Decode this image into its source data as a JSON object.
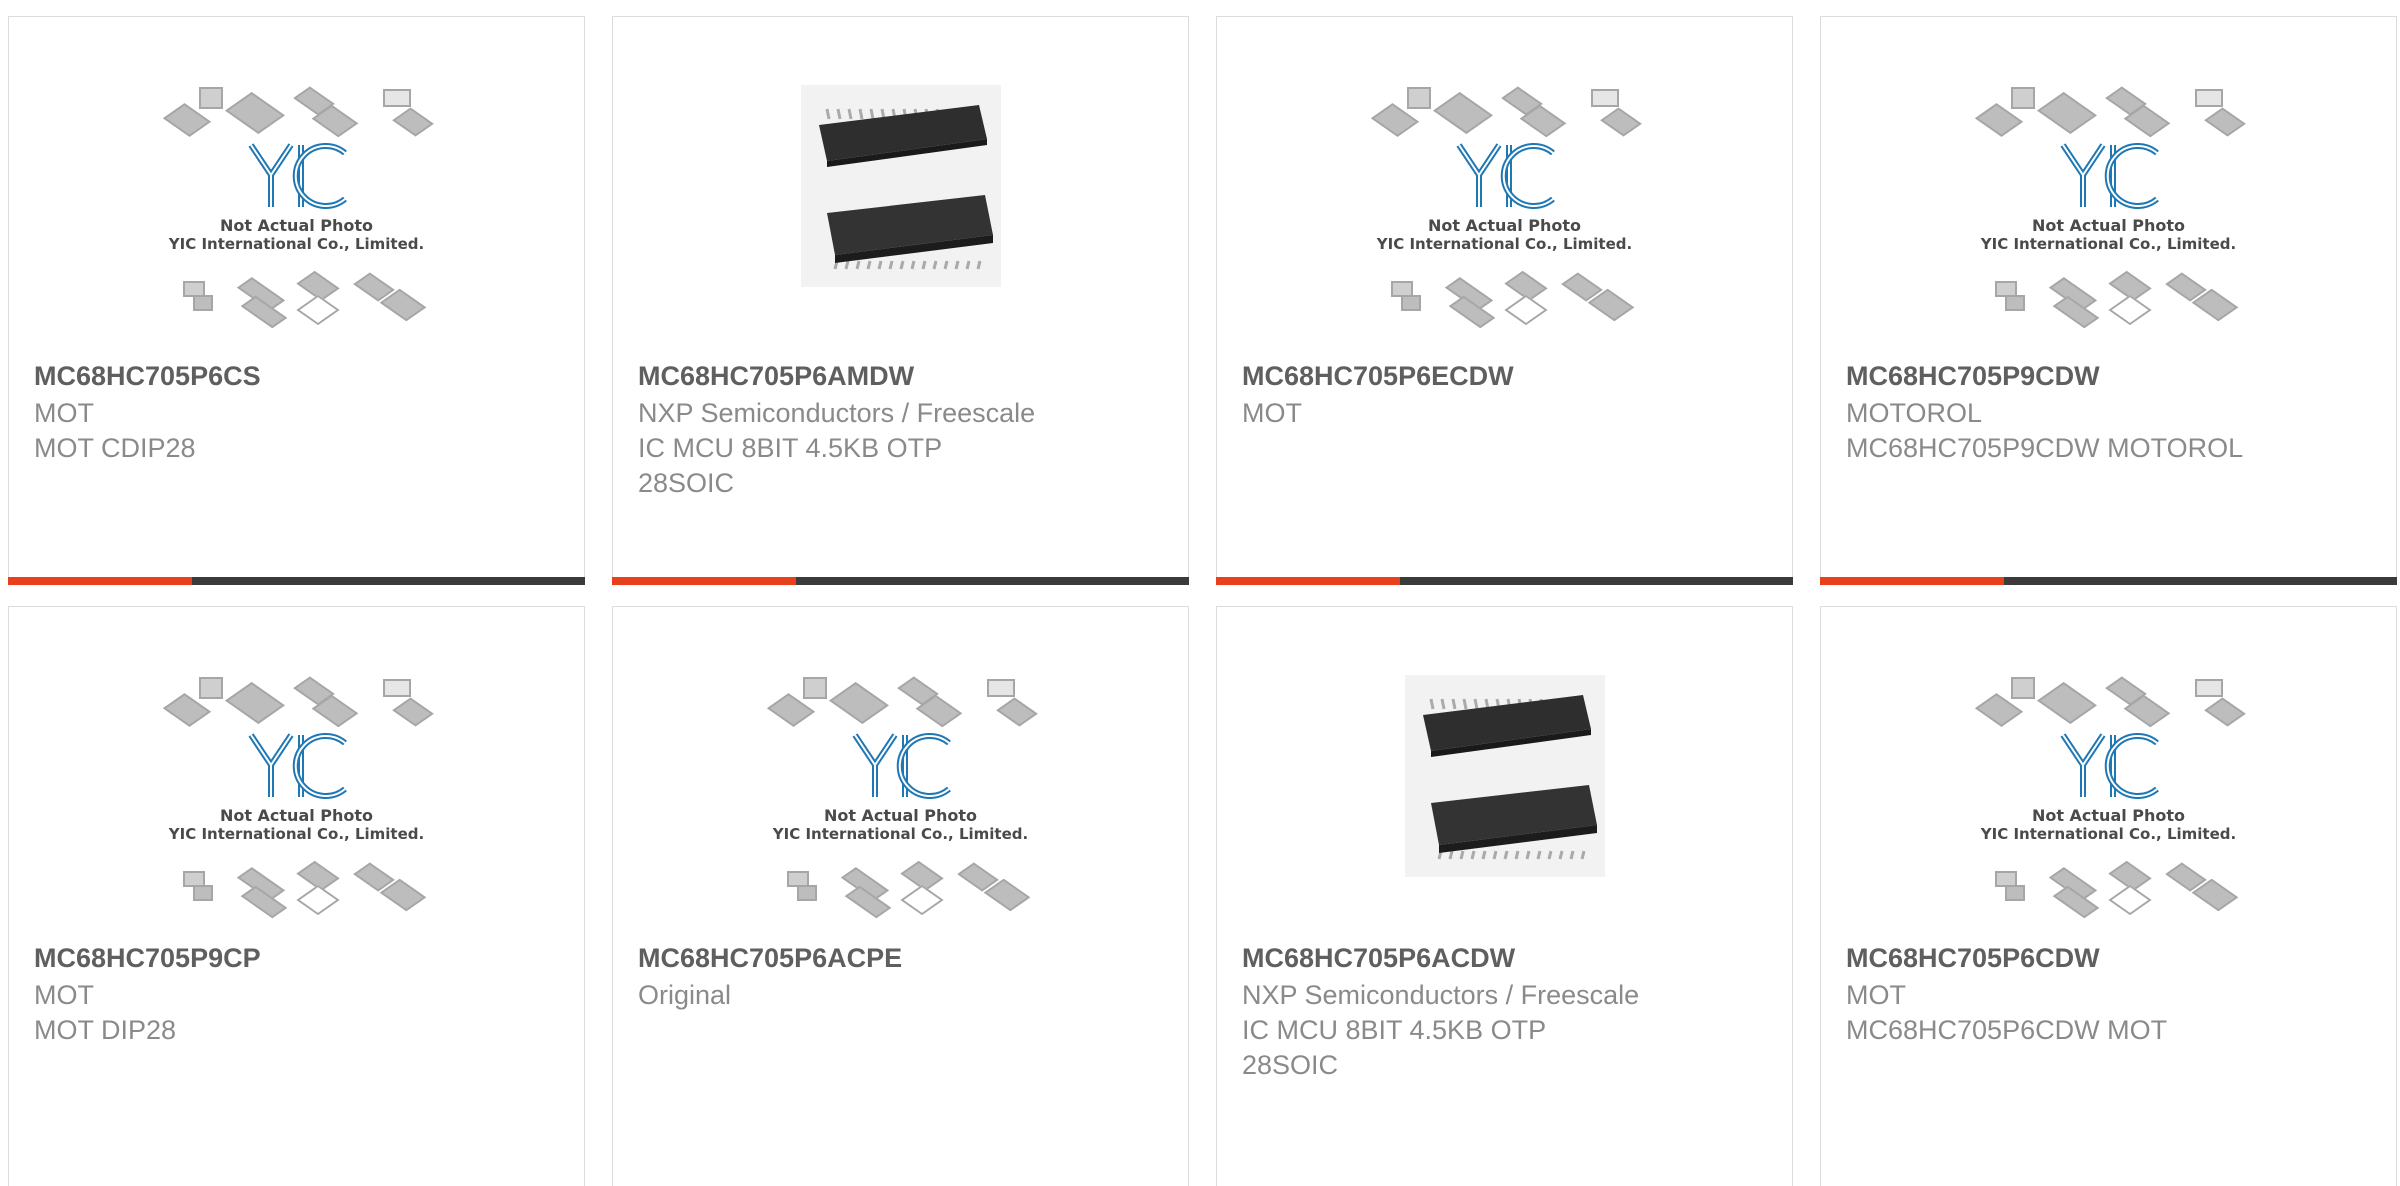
{
  "colors": {
    "accent": "#e8401c",
    "bar_dark": "#3b3b3b"
  },
  "placeholder": {
    "line1": "Not Actual Photo",
    "line2": "YIC International Co., Limited.",
    "logo": "YIC"
  },
  "cards": [
    {
      "part": "MC68HC705P6CS",
      "lines": [
        "MOT",
        "MOT CDIP28"
      ],
      "image": "placeholder"
    },
    {
      "part": "MC68HC705P6AMDW",
      "lines": [
        "NXP Semiconductors / Freescale",
        "IC MCU 8BIT 4.5KB OTP",
        "28SOIC"
      ],
      "image": "soic-photo"
    },
    {
      "part": "MC68HC705P6ECDW",
      "lines": [
        "MOT"
      ],
      "image": "placeholder"
    },
    {
      "part": "MC68HC705P9CDW",
      "lines": [
        "MOTOROL",
        "MC68HC705P9CDW MOTOROL"
      ],
      "image": "placeholder"
    },
    {
      "part": "MC68HC705P9CP",
      "lines": [
        "MOT",
        "MOT DIP28"
      ],
      "image": "placeholder"
    },
    {
      "part": "MC68HC705P6ACPE",
      "lines": [
        "Original"
      ],
      "image": "placeholder"
    },
    {
      "part": "MC68HC705P6ACDW",
      "lines": [
        "NXP Semiconductors / Freescale",
        "IC MCU 8BIT 4.5KB OTP",
        "28SOIC"
      ],
      "image": "soic-photo"
    },
    {
      "part": "MC68HC705P6CDW",
      "lines": [
        "MOT",
        "MC68HC705P6CDW MOT"
      ],
      "image": "placeholder"
    }
  ]
}
